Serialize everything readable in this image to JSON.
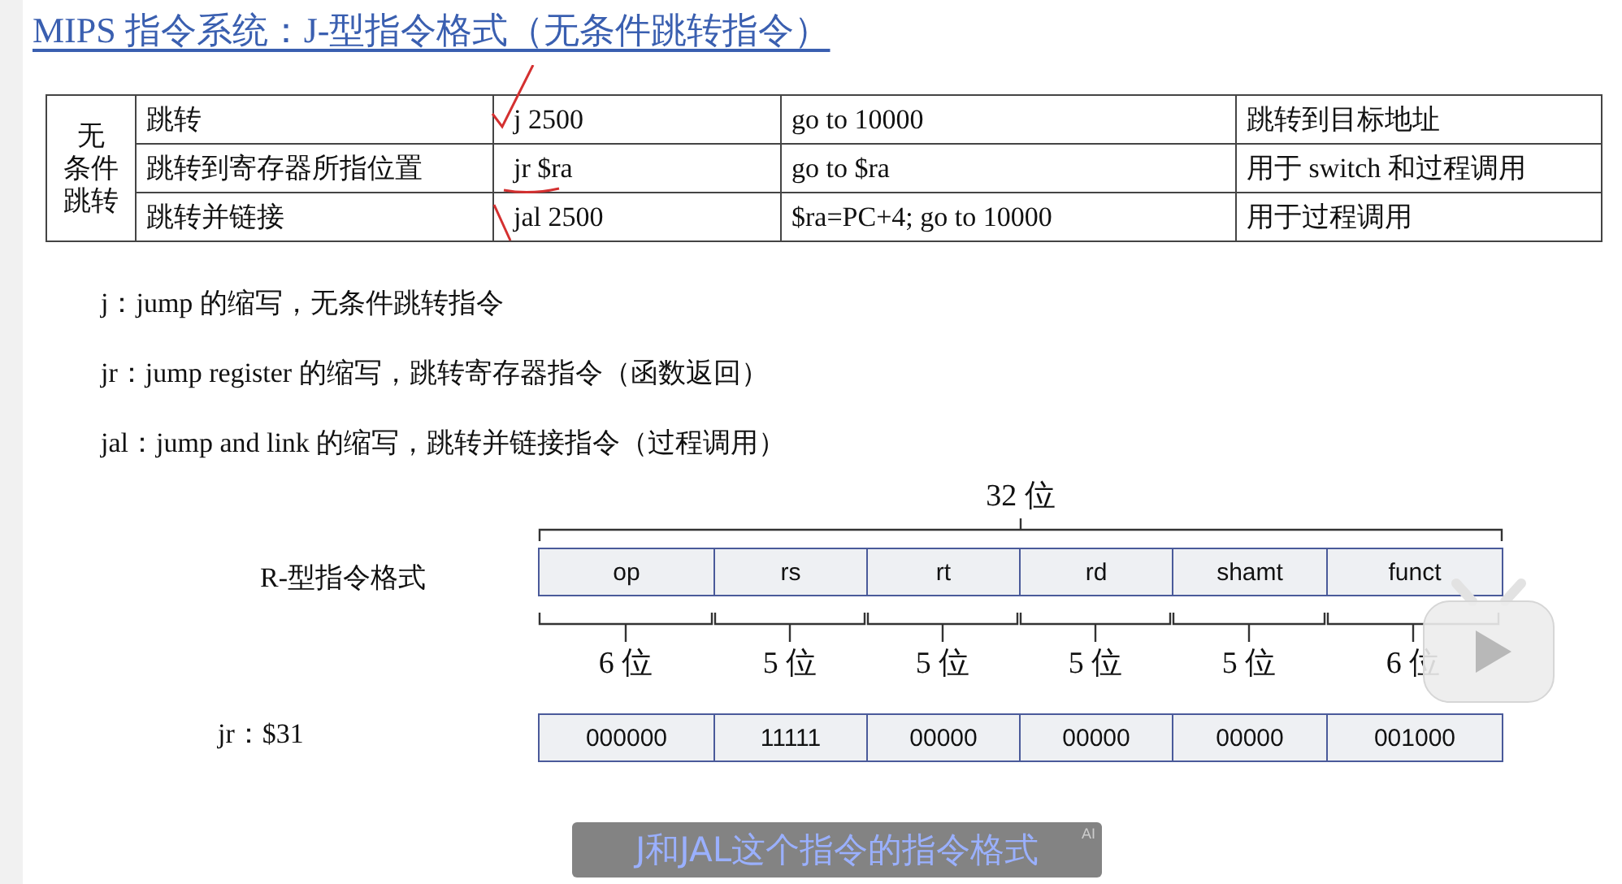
{
  "title": "MIPS 指令系统：J-型指令格式（无条件跳转指令）",
  "table": {
    "group": [
      "无",
      "条件",
      "跳转"
    ],
    "rows": [
      {
        "name": "跳转",
        "example": "j 2500",
        "meaning": "go to 10000",
        "use": "跳转到目标地址"
      },
      {
        "name": "跳转到寄存器所指位置",
        "example": "jr $ra",
        "meaning": "go to $ra",
        "use": "用于 switch 和过程调用"
      },
      {
        "name": "跳转并链接",
        "example": "jal 2500",
        "meaning": "$ra=PC+4; go to 10000",
        "use": "用于过程调用"
      }
    ]
  },
  "notes": [
    "j：jump 的缩写，无条件跳转指令",
    "jr：jump register 的缩写，跳转寄存器指令（函数返回）",
    "jal：jump and link 的缩写，跳转并链接指令（过程调用）"
  ],
  "format": {
    "total": "32 位",
    "label": "R-型指令格式",
    "example_label": "jr：$31",
    "fields": [
      {
        "name": "op",
        "bits": "6 位",
        "value": "000000"
      },
      {
        "name": "rs",
        "bits": "5 位",
        "value": "11111"
      },
      {
        "name": "rt",
        "bits": "5 位",
        "value": "00000"
      },
      {
        "name": "rd",
        "bits": "5 位",
        "value": "00000"
      },
      {
        "name": "shamt",
        "bits": "5 位",
        "value": "00000"
      },
      {
        "name": "funct",
        "bits": "6 位",
        "value": "001000"
      }
    ]
  },
  "subtitle": {
    "text": "J和JAL这个指令的指令格式",
    "badge": "AI"
  }
}
